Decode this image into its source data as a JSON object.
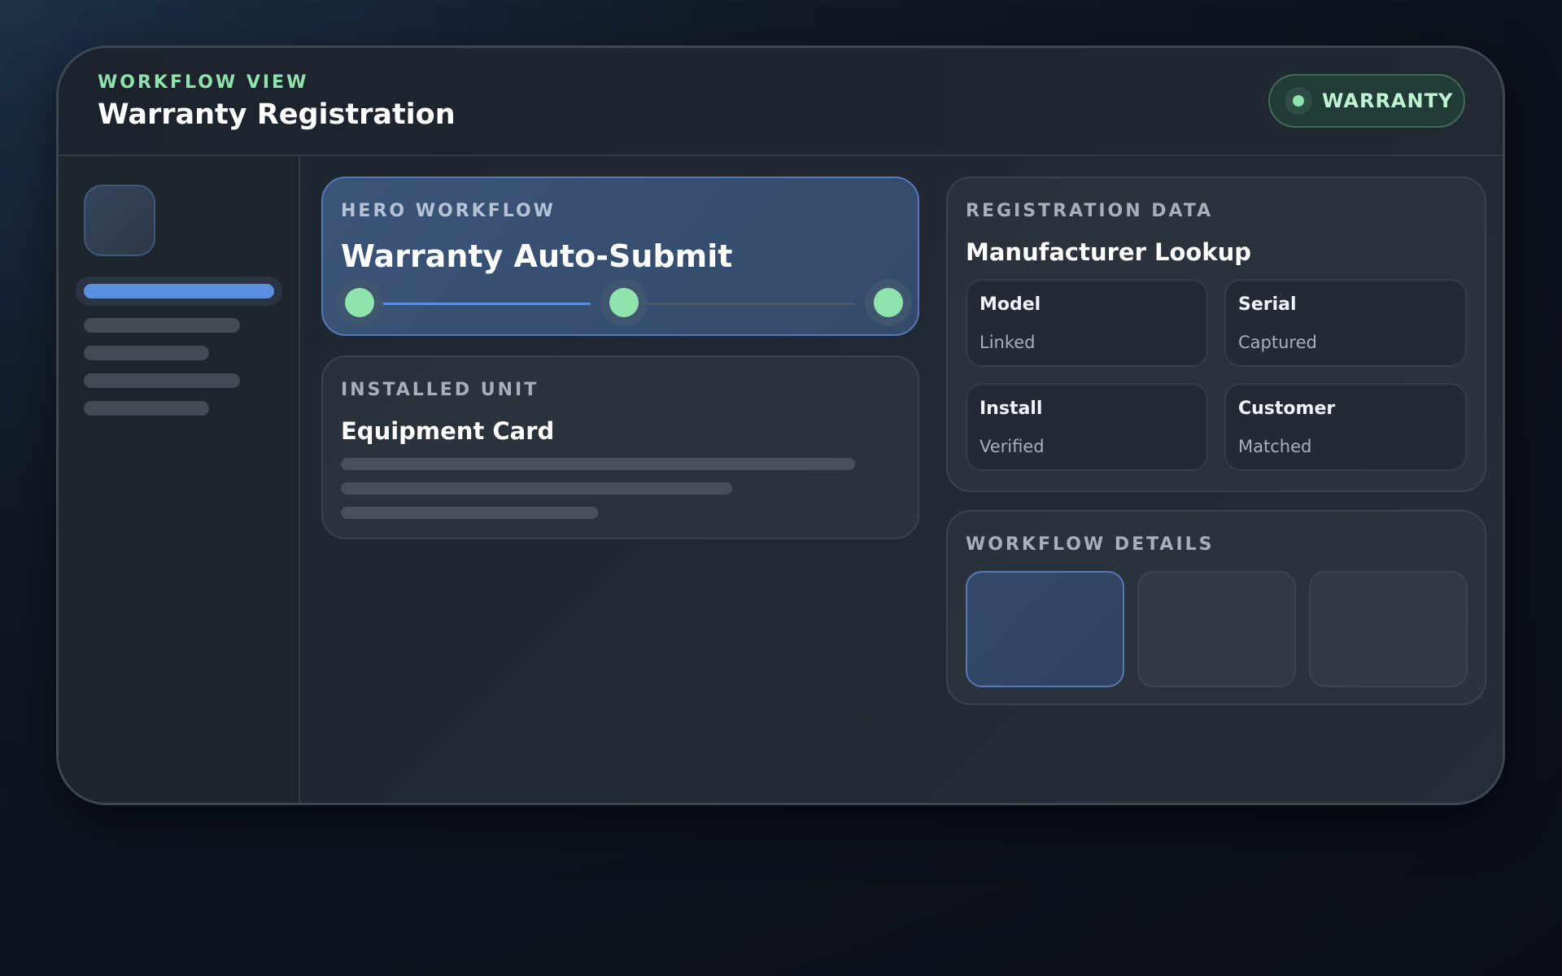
{
  "header": {
    "eyebrow": "WORKFLOW VIEW",
    "title": "Warranty Registration",
    "badge_label": "WARRANTY"
  },
  "colors": {
    "accent_green": "#8fe3ad",
    "accent_blue": "#5b8fe0"
  },
  "sidebar": {
    "active_index": 0,
    "item_count": 5
  },
  "hero": {
    "eyebrow": "HERO WORKFLOW",
    "title": "Warranty Auto-Submit",
    "steps_total": 3,
    "steps_completed": 3,
    "connectors_active": 1
  },
  "installed": {
    "eyebrow": "INSTALLED UNIT",
    "title": "Equipment Card"
  },
  "registration": {
    "eyebrow": "REGISTRATION DATA",
    "title": "Manufacturer Lookup",
    "fields": [
      {
        "label": "Model",
        "value": "Linked"
      },
      {
        "label": "Serial",
        "value": "Captured"
      },
      {
        "label": "Install",
        "value": "Verified"
      },
      {
        "label": "Customer",
        "value": "Matched"
      }
    ]
  },
  "details": {
    "eyebrow": "WORKFLOW DETAILS",
    "tile_count": 3,
    "selected_tile": 0
  }
}
